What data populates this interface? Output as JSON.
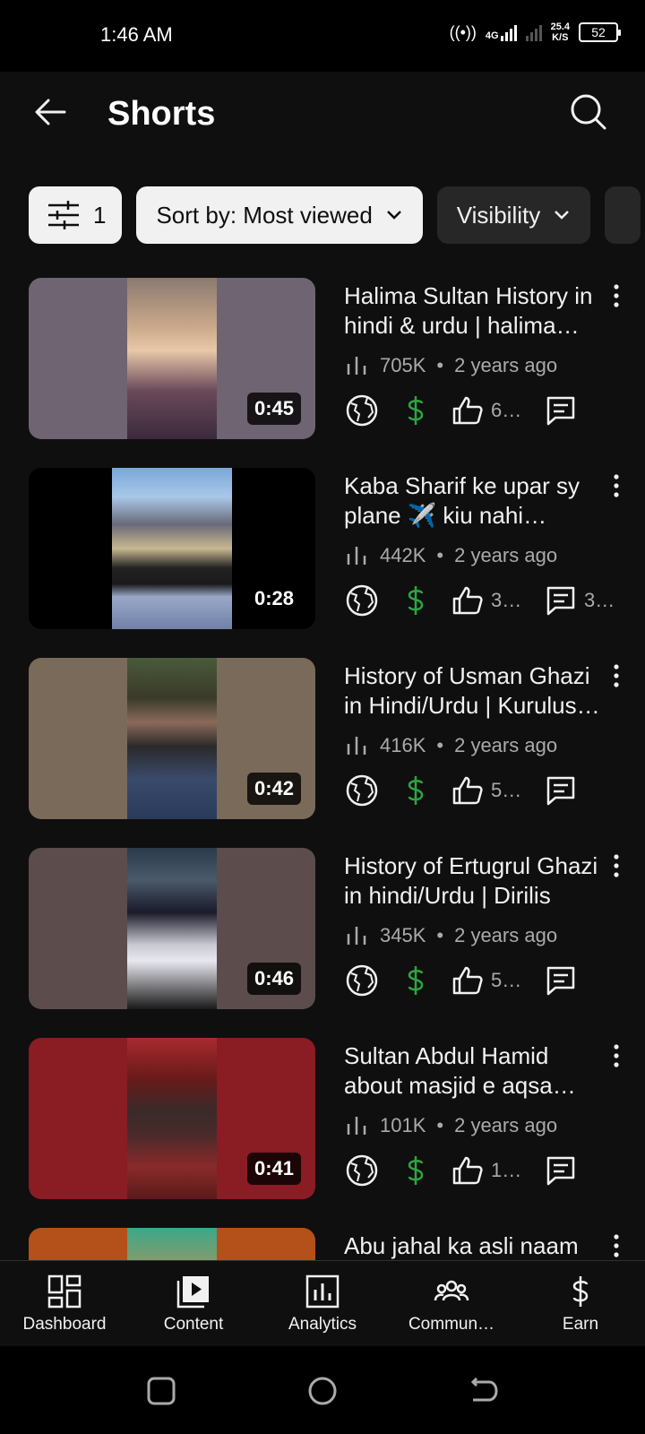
{
  "status_bar": {
    "time": "1:46 AM",
    "network": "4G",
    "speed_value": "25.4",
    "speed_unit": "K/S",
    "battery": "52"
  },
  "header": {
    "title": "Shorts"
  },
  "filters": {
    "filter_count": "1",
    "sort_label": "Sort by: Most viewed",
    "visibility_label": "Visibility"
  },
  "videos": [
    {
      "title": "Halima Sultan History in hindi & urdu | halima sultan",
      "duration": "0:45",
      "views": "705K",
      "age": "2 years ago",
      "likes": "6…",
      "comments": "",
      "thumb_bg": "#6e6472"
    },
    {
      "title": "Kaba Sharif  ke upar sy plane ✈️ kiu nahi guzarta",
      "duration": "0:28",
      "views": "442K",
      "age": "2 years ago",
      "likes": "3…",
      "comments": "3…",
      "thumb_bg": "#000000"
    },
    {
      "title": "History of Usman Ghazi in Hindi/Urdu | Kurulus Osman",
      "duration": "0:42",
      "views": "416K",
      "age": "2 years ago",
      "likes": "5…",
      "comments": "",
      "thumb_bg": "#7a6a5a"
    },
    {
      "title": "History of Ertugrul Ghazi in hindi/Urdu | Dirilis",
      "duration": "0:46",
      "views": "345K",
      "age": "2 years ago",
      "likes": "5…",
      "comments": "",
      "thumb_bg": "#5c4c4c"
    },
    {
      "title": "Sultan Abdul Hamid about masjid e aqsa history",
      "duration": "0:41",
      "views": "101K",
      "age": "2 years ago",
      "likes": "1…",
      "comments": "",
      "thumb_bg": "#8a1c24"
    },
    {
      "title": "Abu jahal ka asli naam",
      "duration": "",
      "views": "",
      "age": "",
      "likes": "",
      "comments": "",
      "thumb_bg": "#b4501a"
    }
  ],
  "bottom_nav": {
    "dashboard": "Dashboard",
    "content": "Content",
    "analytics": "Analytics",
    "community": "Commun…",
    "earn": "Earn"
  },
  "colors": {
    "background": "#0f0f0f",
    "chip_light": "#f1f1f1",
    "chip_dark": "#272727",
    "monetized_green": "#2ba640",
    "secondary_text": "#aaaaaa"
  },
  "icons": {
    "back": "arrow-left-icon",
    "search": "search-icon",
    "filter": "sliders-icon",
    "sort": "chevron-down-icon",
    "visibility_public": "globe-icon",
    "monetization": "dollar-icon",
    "likes": "thumbs-up-icon",
    "comments": "comment-icon",
    "views": "bar-chart-icon",
    "more": "more-vert-icon"
  }
}
